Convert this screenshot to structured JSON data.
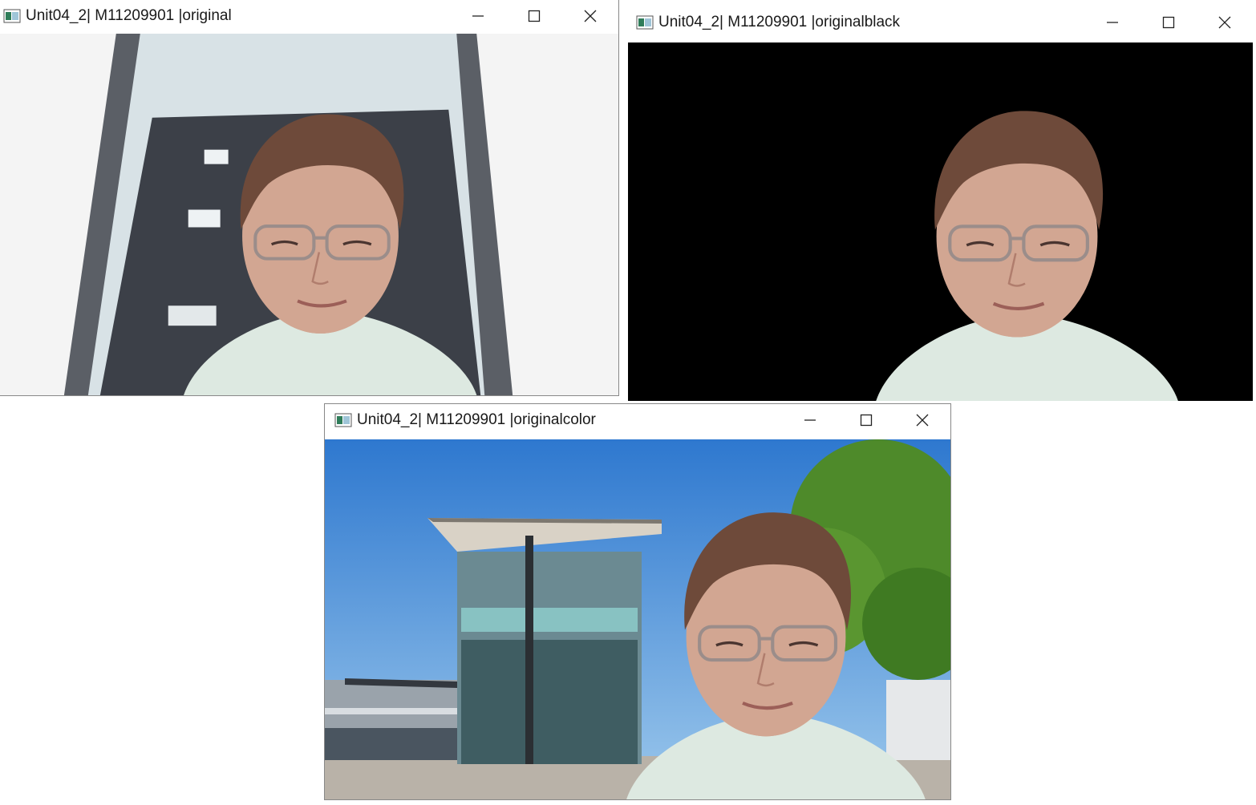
{
  "windows": [
    {
      "title": "Unit04_2| M11209901 |original",
      "controls": {
        "minimize": "minimize-icon",
        "maximize": "maximize-icon",
        "close": "close-icon"
      }
    },
    {
      "title": "Unit04_2| M11209901 |originalblack",
      "controls": {
        "minimize": "minimize-icon",
        "maximize": "maximize-icon",
        "close": "close-icon"
      }
    },
    {
      "title": "Unit04_2| M11209901 |originalcolor",
      "controls": {
        "minimize": "minimize-icon",
        "maximize": "maximize-icon",
        "close": "close-icon"
      }
    }
  ],
  "colors": {
    "skin": "#cfa392",
    "hair": "#6e4a3a",
    "shirt": "#dfeee3",
    "sky": "#3f86d6",
    "tree": "#4f8a2a",
    "black_bg": "#000000"
  }
}
